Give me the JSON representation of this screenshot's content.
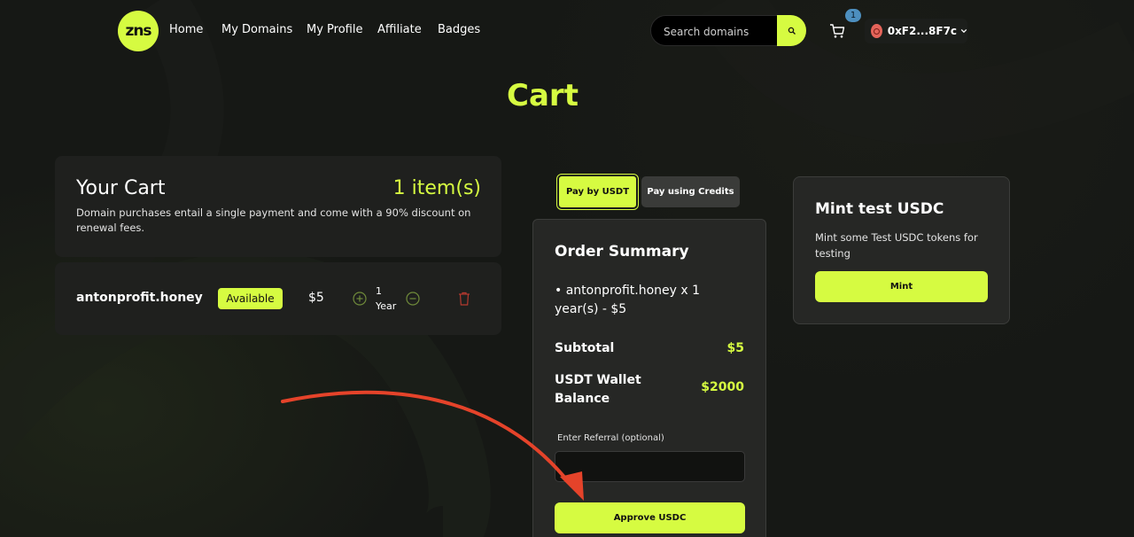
{
  "nav": {
    "logo_text": "zns",
    "links": [
      "Home",
      "My Domains",
      "My Profile",
      "Affiliate",
      "Badges"
    ],
    "search_placeholder": "Search domains",
    "cart_count": "1",
    "wallet_address": "0xF2...8F7c"
  },
  "page_title": "Cart",
  "cart": {
    "heading": "Your Cart",
    "item_count": "1 item(s)",
    "description": "Domain purchases entail a single payment and come with a 90% discount on renewal fees.",
    "items": [
      {
        "domain": "antonprofit.honey",
        "status": "Available",
        "price": "$5",
        "qty_number": "1",
        "qty_unit": "Year"
      }
    ]
  },
  "payment_toggle": {
    "usdt_label": "Pay by USDT",
    "credits_label": "Pay using Credits",
    "selected": "Pay by USDT"
  },
  "order_summary": {
    "title": "Order Summary",
    "line_item": "• antonprofit.honey x 1 year(s) - $5",
    "subtotal_label": "Subtotal",
    "subtotal_value": "$5",
    "balance_label": "USDT Wallet Balance",
    "balance_value": "$2000",
    "referral_label": "Enter Referral (optional)",
    "referral_value": "",
    "approve_label": "Approve USDC"
  },
  "mint": {
    "title": "Mint test USDC",
    "description": "Mint some Test USDC tokens for testing",
    "button_label": "Mint"
  },
  "colors": {
    "accent": "#d6fb41",
    "background": "#161815",
    "card": "#262725",
    "annotation_arrow": "#e5432a",
    "delete_icon": "#b5392f"
  },
  "icons": {
    "search": "search-icon",
    "cart": "cart-icon",
    "chevron": "chevron-down-icon",
    "plus": "plus-circle-icon",
    "minus": "minus-circle-icon",
    "delete": "trash-icon"
  }
}
